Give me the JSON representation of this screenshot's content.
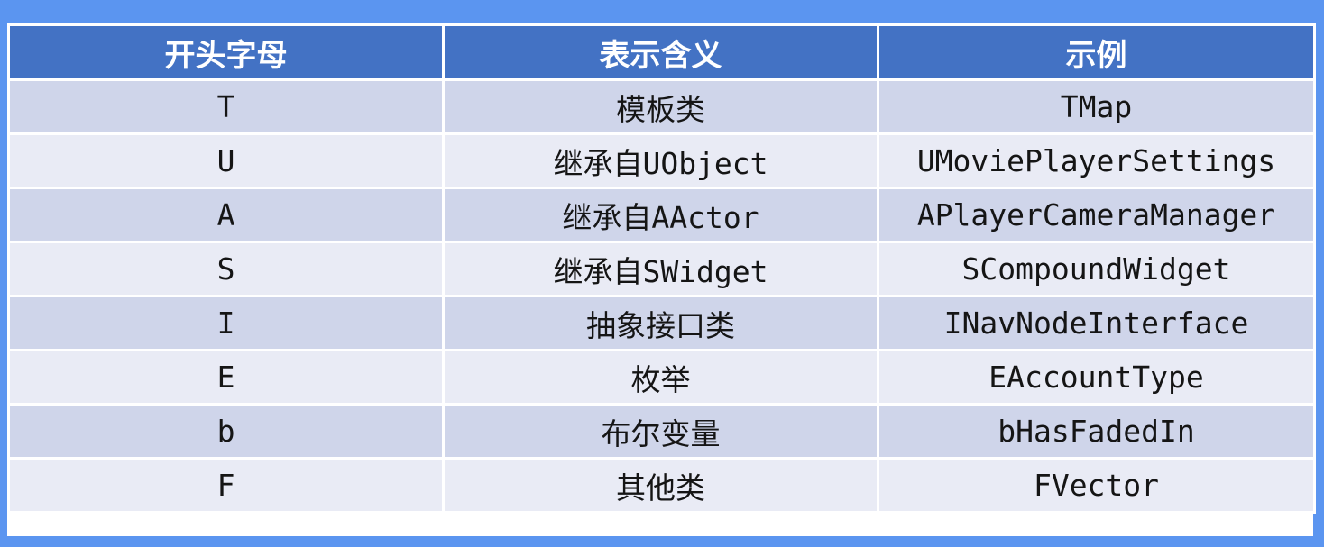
{
  "table": {
    "headers": [
      "开头字母",
      "表示含义",
      "示例"
    ],
    "rows": [
      {
        "prefix": "T",
        "meaning": "模板类",
        "example": "TMap"
      },
      {
        "prefix": "U",
        "meaning": "继承自UObject",
        "example": "UMoviePlayerSettings"
      },
      {
        "prefix": "A",
        "meaning": "继承自AActor",
        "example": "APlayerCameraManager"
      },
      {
        "prefix": "S",
        "meaning": "继承自SWidget",
        "example": "SCompoundWidget"
      },
      {
        "prefix": "I",
        "meaning": "抽象接口类",
        "example": "INavNodeInterface"
      },
      {
        "prefix": "E",
        "meaning": "枚举",
        "example": "EAccountType"
      },
      {
        "prefix": "b",
        "meaning": "布尔变量",
        "example": "bHasFadedIn"
      },
      {
        "prefix": "F",
        "meaning": "其他类",
        "example": "FVector"
      }
    ]
  },
  "colors": {
    "background": "#5b95f0",
    "header_fill": "#4372c4",
    "row_dark": "#cfd5ea",
    "row_light": "#e9ebf5"
  }
}
